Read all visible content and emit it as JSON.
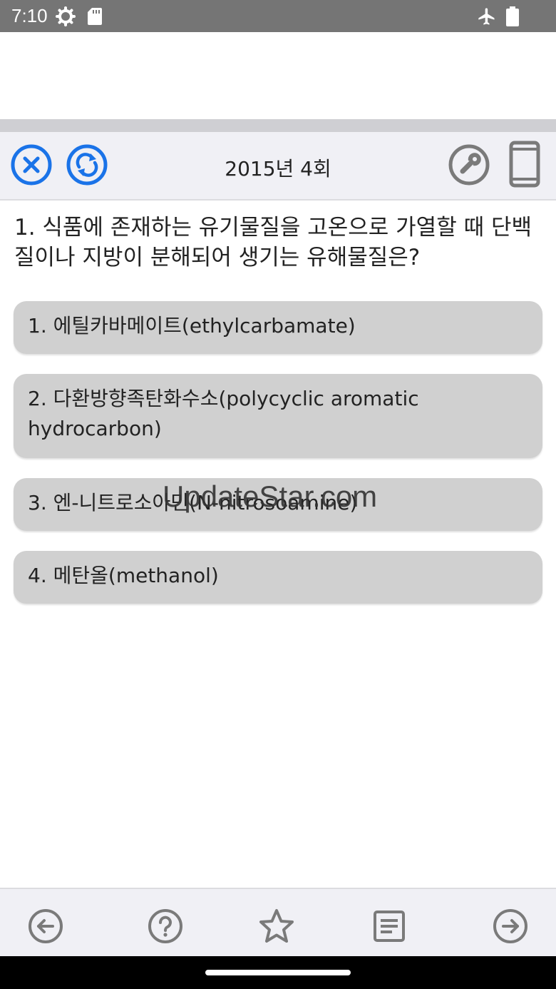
{
  "status_bar": {
    "time": "7:10"
  },
  "toolbar": {
    "title": "2015년 4회"
  },
  "question": {
    "text": "1. 식품에 존재하는 유기물질을 고온으로 가열할 때 단백질이나 지방이 분해되어 생기는 유해물질은?"
  },
  "options": [
    {
      "label": "1. 에틸카바메이트(ethylcarbamate)"
    },
    {
      "label": "2. 다환방향족탄화수소(polycyclic aromatic hydrocarbon)"
    },
    {
      "label": "3. 엔-니트로소아민(N-nitrosoamine)"
    },
    {
      "label": "4. 메탄올(methanol)"
    }
  ],
  "watermark": "UpdateStar.com",
  "colors": {
    "accent_blue": "#1a73e8",
    "icon_gray": "#7a7a7a",
    "option_bg": "#d0d0d0",
    "statusbar_bg": "#757575"
  },
  "icons": {
    "toolbar_left": [
      "close-icon",
      "refresh-icon"
    ],
    "toolbar_right": [
      "wrench-icon",
      "phone-icon"
    ],
    "bottom": [
      "prev-icon",
      "help-icon",
      "star-icon",
      "notes-icon",
      "next-icon"
    ]
  }
}
